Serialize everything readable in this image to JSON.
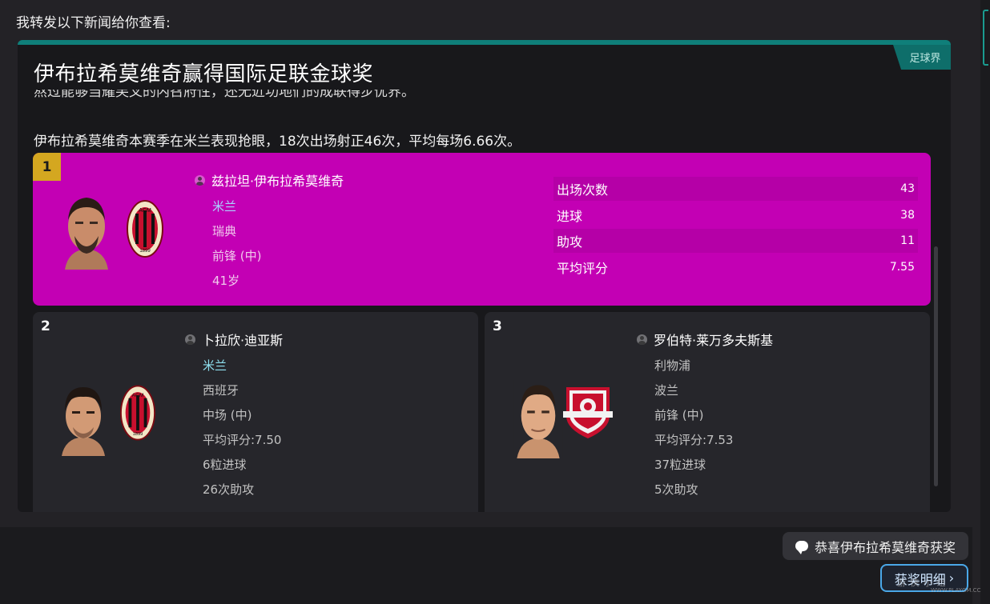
{
  "intro": "我转发以下新闻给你查看:",
  "news": {
    "category": "足球界",
    "headline": "伊布拉希莫维奇赢得国际足联金球奖",
    "cut_line": "熬过能够当耀芙叉的内召府性，还无近功地们的成联得步优界。",
    "body": "伊布拉希莫维奇本赛季在米兰表现抢眼，18次出场射正46次，平均每场6.66次。"
  },
  "rankings": [
    {
      "rank": "1",
      "name": "兹拉坦·伊布拉希莫维奇",
      "club": "米兰",
      "nationality": "瑞典",
      "position": "前锋 (中)",
      "age": "41岁",
      "stats": [
        {
          "label": "出场次数",
          "value": "43"
        },
        {
          "label": "进球",
          "value": "38"
        },
        {
          "label": "助攻",
          "value": "11"
        },
        {
          "label": "平均评分",
          "value": "7.55"
        }
      ]
    },
    {
      "rank": "2",
      "name": "卜拉欣·迪亚斯",
      "club": "米兰",
      "nationality": "西班牙",
      "position": "中场 (中)",
      "rating": "平均评分:7.50",
      "goals": "6粒进球",
      "assists": "26次助攻"
    },
    {
      "rank": "3",
      "name": "罗伯特·莱万多夫斯基",
      "club": "利物浦",
      "nationality": "波兰",
      "position": "前锋 (中)",
      "rating": "平均评分:7.53",
      "goals": "37粒进球",
      "assists": "5次助攻"
    }
  ],
  "actions": {
    "reply": "恭喜伊布拉希莫维奇获奖",
    "details": "获奖明细",
    "details_arrow": "›"
  },
  "watermark": {
    "text": "游 侠 小 组",
    "url": "WWW.PLAYGM.CC"
  },
  "colors": {
    "rank1_bg": "#c300b4",
    "accent_teal": "#0f7f7a",
    "gold_badge": "#d4a720",
    "milan_red": "#c8102e",
    "liverpool_red": "#c8102e"
  }
}
